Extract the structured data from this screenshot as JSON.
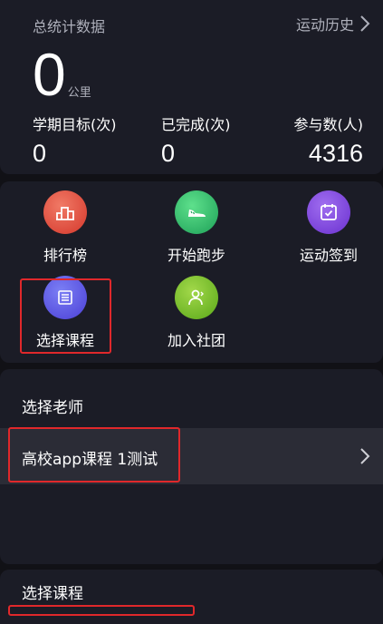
{
  "stats": {
    "title": "总统计数据",
    "history_label": "运动历史",
    "distance_value": "0",
    "distance_unit": "公里",
    "columns": [
      {
        "label": "学期目标(次)",
        "value": "0"
      },
      {
        "label": "已完成(次)",
        "value": "0"
      },
      {
        "label": "参与数(人)",
        "value": "4316"
      }
    ]
  },
  "menu": {
    "items": [
      {
        "label": "排行榜",
        "icon": "ranking-podium-icon",
        "color": "#d5372b"
      },
      {
        "label": "开始跑步",
        "icon": "running-shoe-icon",
        "color": "#1da057"
      },
      {
        "label": "运动签到",
        "icon": "calendar-check-icon",
        "color": "#6a30cf"
      },
      {
        "label": "选择课程",
        "icon": "course-list-icon",
        "color": "#4b3fd6"
      },
      {
        "label": "加入社团",
        "icon": "club-people-icon",
        "color": "#5aa819"
      }
    ]
  },
  "teacher": {
    "section_title": "选择老师",
    "selected": "高校app课程 1测试",
    "chevron_icon": "chevron-right-icon"
  },
  "course": {
    "section_title": "选择课程"
  },
  "colors": {
    "background": "#111116",
    "card": "#1b1c26",
    "row": "#2b2c36",
    "highlight": "#e0282b",
    "muted_text": "#aeb0bb"
  }
}
